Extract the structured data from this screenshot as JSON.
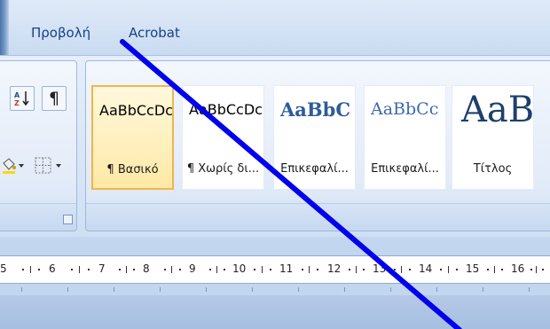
{
  "menu": {
    "tabs": [
      {
        "label": "Προβολή"
      },
      {
        "label": "Acrobat"
      }
    ]
  },
  "paragraph_group": {
    "sort_icon": "sort-az-icon",
    "show_formatting_label": "¶",
    "shading_icon": "shading-paint-bucket-icon",
    "borders_icon": "borders-grid-icon",
    "launcher_icon": "dialog-launcher-icon"
  },
  "styles_gallery": {
    "tiles": [
      {
        "preview": "AaBbCcDc",
        "label": "¶ Βασικό",
        "selected": true
      },
      {
        "preview": "AaBbCcDc",
        "label": "¶ Χωρίς δι...",
        "selected": false
      },
      {
        "preview": "AaBbC",
        "label": "Επικεφαλί...",
        "selected": false
      },
      {
        "preview": "AaBbCc",
        "label": "Επικεφαλί...",
        "selected": false
      },
      {
        "preview": "AaB",
        "label": "Τίτλος",
        "selected": false
      }
    ]
  },
  "ruler": {
    "numbers": [
      "5",
      "6",
      "7",
      "8",
      "9",
      "10",
      "11",
      "12",
      "13",
      "14",
      "15",
      "16"
    ]
  },
  "colors": {
    "annotation_line": "#0000ee",
    "tab_text": "#15428b",
    "selected_tile_border": "#f2b548",
    "heading_blue": "#2e5b9a"
  }
}
